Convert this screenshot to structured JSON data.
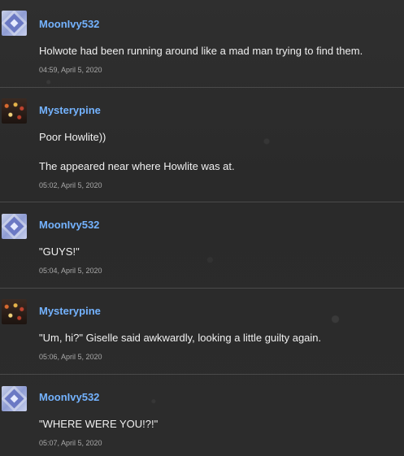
{
  "posts": [
    {
      "username": "MoonIvy532",
      "avatar": "diamond-avatar",
      "messages": [
        "Holwote had been running around like a mad man trying to find them."
      ],
      "time": "04:59, April 5, 2020"
    },
    {
      "username": "Mysterypine",
      "avatar": "lights-avatar",
      "messages": [
        "Poor Howlite))",
        "The appeared near where Howlite was at."
      ],
      "time": "05:02, April 5, 2020"
    },
    {
      "username": "MoonIvy532",
      "avatar": "diamond-avatar",
      "messages": [
        "\"GUYS!\""
      ],
      "time": "05:04, April 5, 2020"
    },
    {
      "username": "Mysterypine",
      "avatar": "lights-avatar",
      "messages": [
        "\"Um, hi?\" Giselle said awkwardly, looking a little guilty again."
      ],
      "time": "05:06, April 5, 2020"
    },
    {
      "username": "MoonIvy532",
      "avatar": "diamond-avatar",
      "messages": [
        "\"WHERE WERE YOU!?!\""
      ],
      "time": "05:07, April 5, 2020"
    }
  ],
  "colors": {
    "background": "#2b2b2b",
    "username": "#74b3ff",
    "timestamp": "#a9a9a9",
    "divider": "#4a4a4a"
  }
}
